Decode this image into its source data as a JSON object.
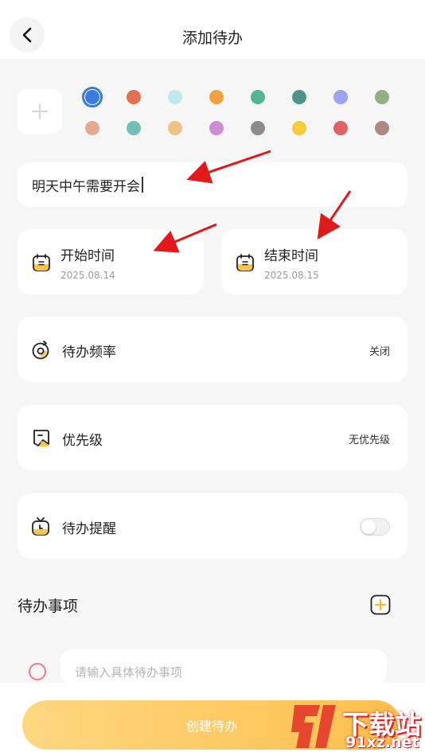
{
  "header": {
    "title": "添加待办"
  },
  "colors": {
    "row1": [
      "#3a7be0",
      "#e3704f",
      "#bfeae9",
      "#f1a23f",
      "#55b594",
      "#4b9688",
      "#9ea2f2",
      "#94ae85"
    ],
    "row2": [
      "#e7a98e",
      "#73bfb7",
      "#ecc387",
      "#cc8dd3",
      "#8a8a8a",
      "#f7cc3b",
      "#e06262",
      "#ad8a7f"
    ],
    "selected_index": 0
  },
  "form": {
    "title_value": "明天中午需要开会",
    "start": {
      "label": "开始时间",
      "date": "2025.08.14"
    },
    "end": {
      "label": "结束时间",
      "date": "2025.08.15"
    },
    "frequency": {
      "label": "待办频率",
      "value": "关闭"
    },
    "priority": {
      "label": "优先级",
      "value": "无优先级"
    },
    "reminder": {
      "label": "待办提醒",
      "enabled": false
    }
  },
  "todos": {
    "section_title": "待办事项",
    "placeholder": "请输入具体待办事项"
  },
  "footer": {
    "create_label": "创建待办"
  },
  "watermark": {
    "brand": "下载站",
    "site": "91xz.net"
  }
}
